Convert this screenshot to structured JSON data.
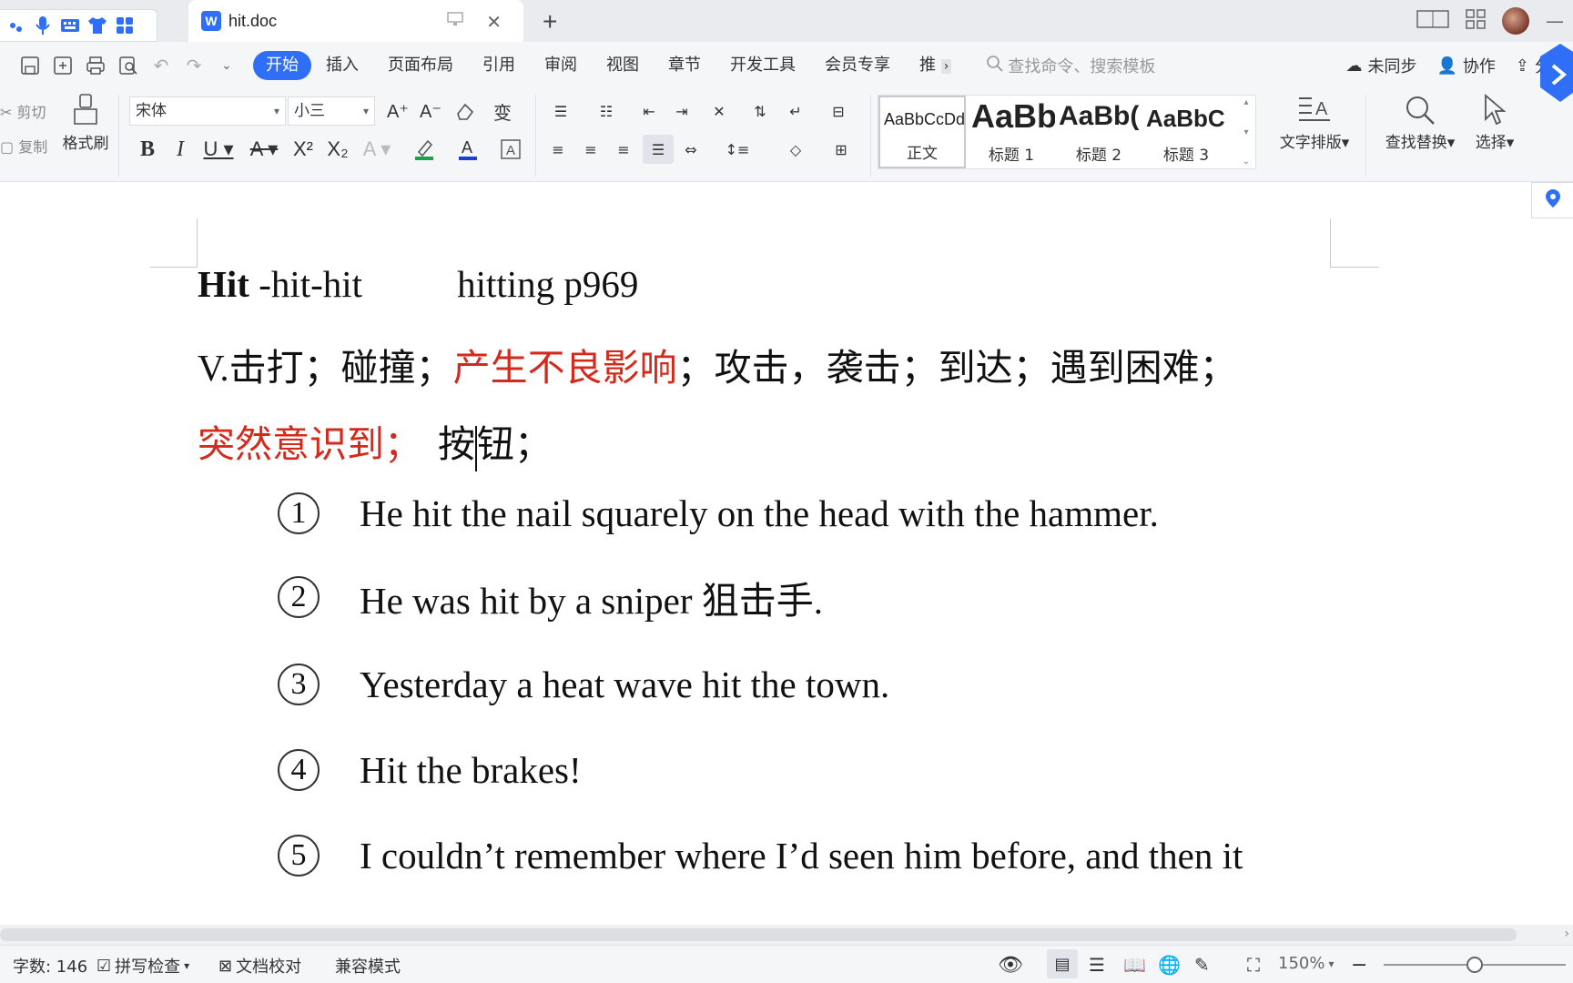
{
  "window": {
    "doc_tab_title": "hit.doc",
    "new_tab": "+"
  },
  "menu": {
    "items": [
      "开始",
      "插入",
      "页面布局",
      "引用",
      "审阅",
      "视图",
      "章节",
      "开发工具",
      "会员专享",
      "推"
    ],
    "search_placeholder": "查找命令、搜索模板",
    "unsync": "未同步",
    "collab": "协作",
    "share": "分享"
  },
  "ribbon": {
    "cut": "剪切",
    "copy": "复制",
    "format_painter": "格式刷",
    "font_name": "宋体",
    "font_size": "小三",
    "styles": [
      {
        "sample": "AaBbCcDd",
        "name": "正文"
      },
      {
        "sample": "AaBb",
        "name": "标题 1"
      },
      {
        "sample": "AaBb(",
        "name": "标题 2"
      },
      {
        "sample": "AaBbC",
        "name": "标题 3"
      }
    ],
    "text_layout": "文字排版",
    "find_replace": "查找替换",
    "select": "选择"
  },
  "document": {
    "line1_bold": "Hit",
    "line1_rest": " -hit-hit",
    "line1_ing": "hitting p969",
    "line2_a": "V.击打；碰撞；",
    "line2_red": "产生不良影响",
    "line2_b": "；攻击，袭击；到达；遇到困难；",
    "line3_red": "突然意识到；",
    "line3_a": "按",
    "line3_b": "钮；",
    "examples": [
      {
        "num": "1",
        "text": "He hit the nail squarely on the head with the hammer."
      },
      {
        "num": "2",
        "text": "He was hit by a sniper 狙击手."
      },
      {
        "num": "3",
        "text": "Yesterday a heat wave hit the town."
      },
      {
        "num": "4",
        "text": "Hit the brakes!"
      },
      {
        "num": "5",
        "text": "I couldn’t remember where I’d seen him before, and then it"
      }
    ]
  },
  "status": {
    "word_count": "字数: 146",
    "spell_check": "拼写检查",
    "proofread": "文档校对",
    "compat_mode": "兼容模式",
    "zoom": "150%",
    "zoom_fraction": 0.5
  },
  "colors": {
    "accent": "#2f6ef7",
    "highlight_red": "#d42a1c"
  }
}
